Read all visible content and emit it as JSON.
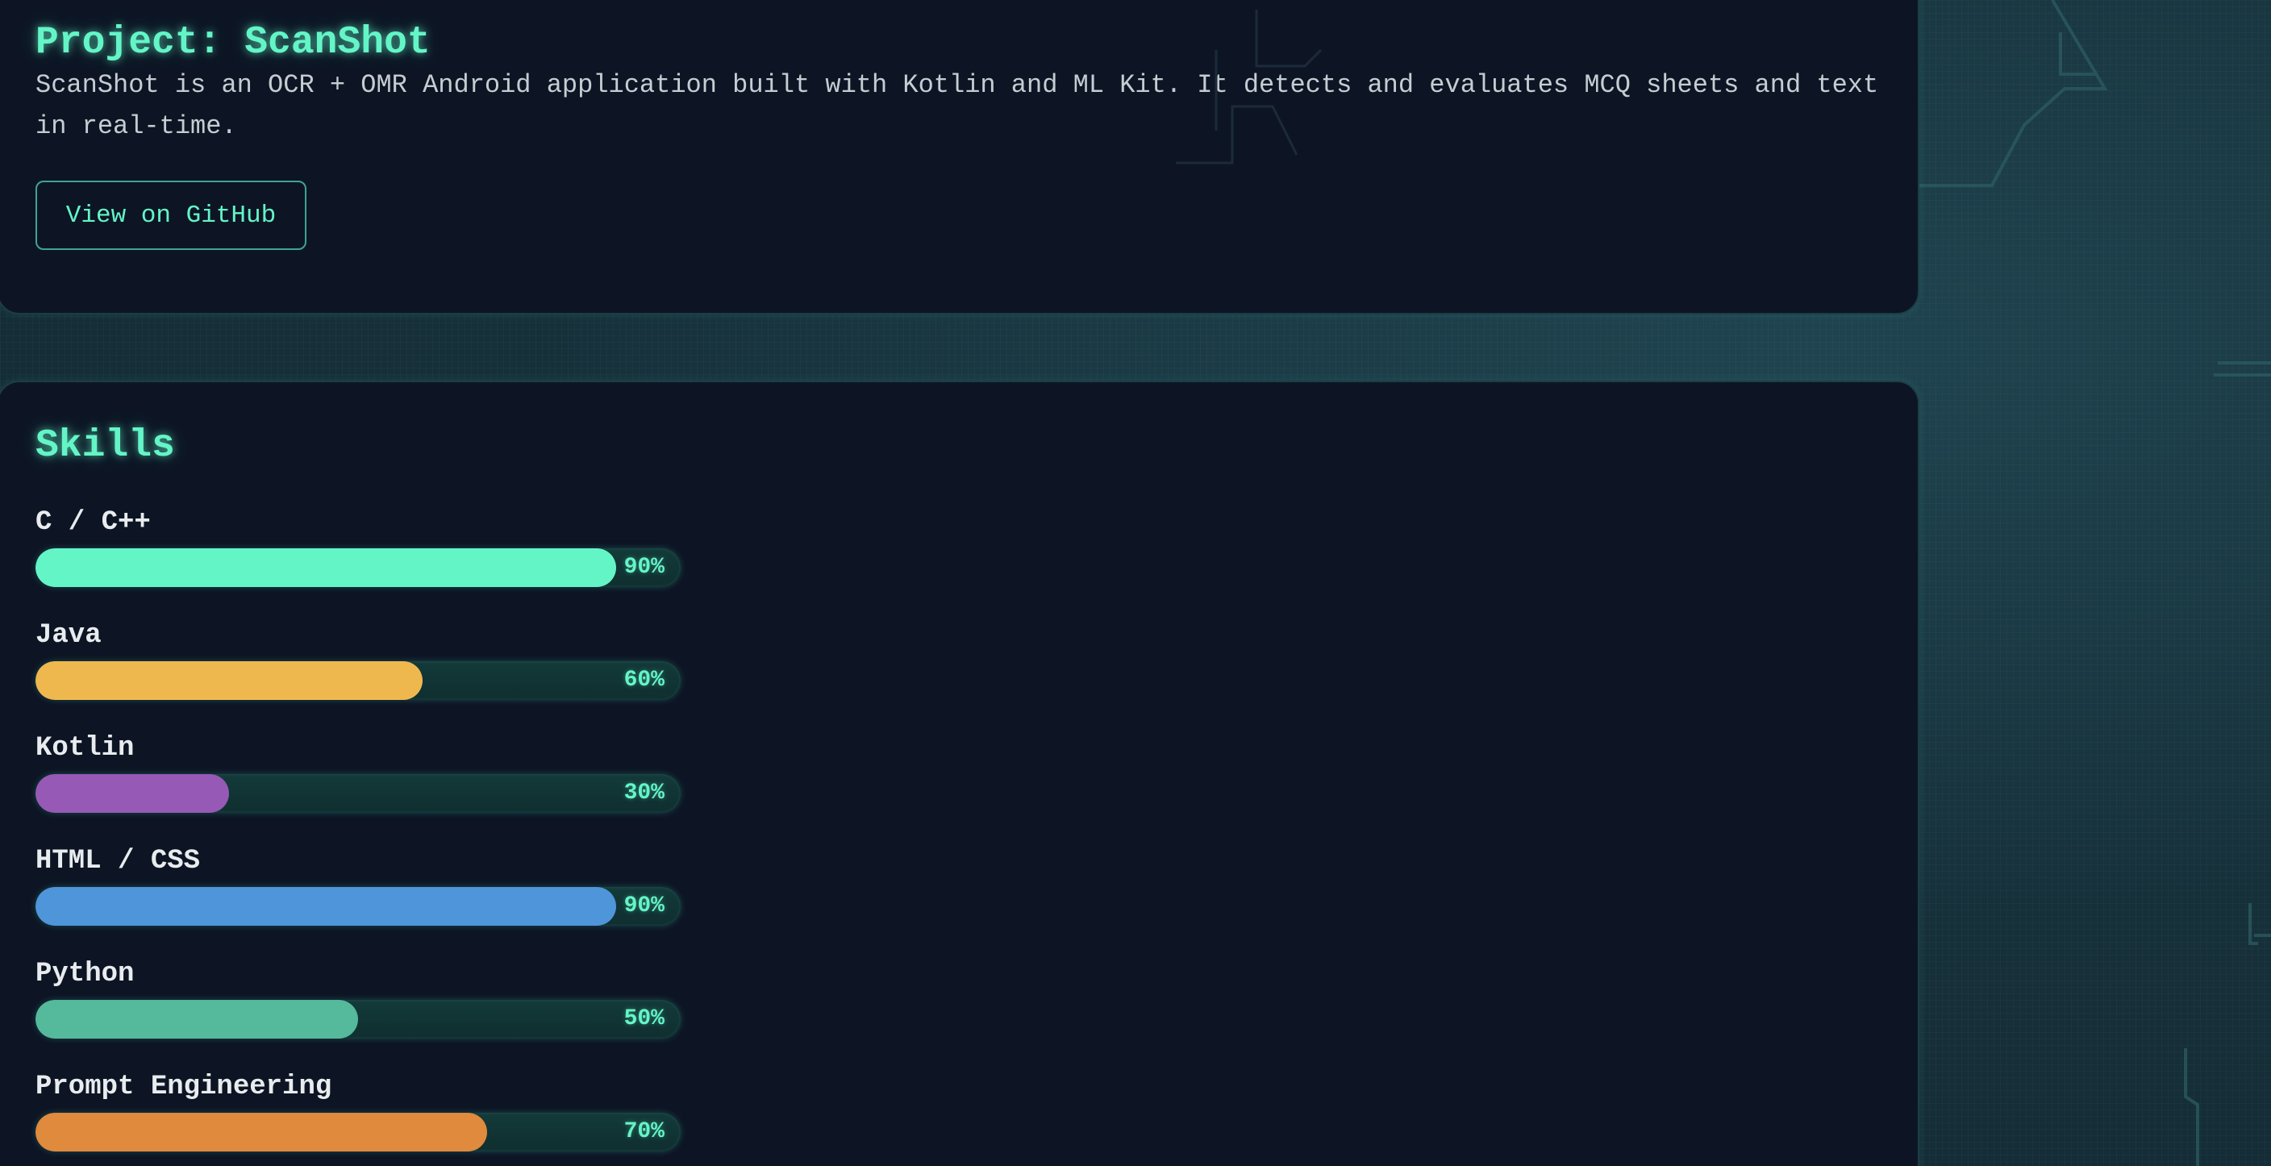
{
  "project": {
    "title": "Project: ScanShot",
    "description": "ScanShot is an OCR + OMR Android application built with Kotlin and ML Kit. It detects and evaluates MCQ sheets and text in real-time.",
    "github_label": "View on GitHub"
  },
  "skills": {
    "title": "Skills",
    "items": [
      {
        "name": "C / C++",
        "percent": 90,
        "percent_label": "90%",
        "color": "#64f5c7"
      },
      {
        "name": "Java",
        "percent": 60,
        "percent_label": "60%",
        "color": "#efb84f"
      },
      {
        "name": "Kotlin",
        "percent": 30,
        "percent_label": "30%",
        "color": "#9659b5"
      },
      {
        "name": "HTML / CSS",
        "percent": 90,
        "percent_label": "90%",
        "color": "#4f95d9"
      },
      {
        "name": "Python",
        "percent": 50,
        "percent_label": "50%",
        "color": "#55b99b"
      },
      {
        "name": "Prompt Engineering",
        "percent": 70,
        "percent_label": "70%",
        "color": "#df8a3c"
      }
    ]
  },
  "colors": {
    "accent": "#64f5c7",
    "card_background": "#0d1524",
    "page_background": "#18303a"
  }
}
